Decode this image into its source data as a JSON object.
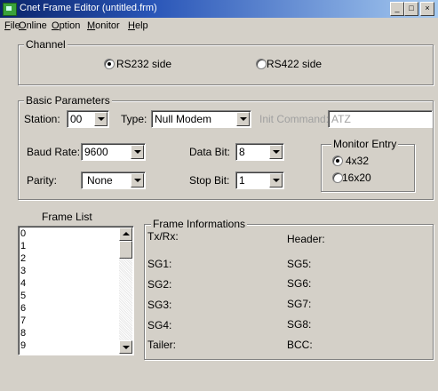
{
  "window": {
    "title": "Cnet Frame Editor (untitled.frm)",
    "min": "_",
    "max": "□",
    "close": "×"
  },
  "menu": [
    "File",
    "Online",
    "Option",
    "Monitor",
    "Help"
  ],
  "channel": {
    "legend": "Channel",
    "rs232": "RS232 side",
    "rs422": "RS422 side",
    "selected": "rs232"
  },
  "basic": {
    "legend": "Basic Parameters",
    "station_label": "Station:",
    "station": "00",
    "type_label": "Type:",
    "type": "Null Modem",
    "init_label": "Init Command:",
    "init": "ATZ",
    "baud_label": "Baud Rate:",
    "baud": "9600",
    "databit_label": "Data Bit:",
    "databit": "8",
    "parity_label": "Parity:",
    "parity": "None",
    "stopbit_label": "Stop Bit:",
    "stopbit": "1"
  },
  "monitor": {
    "legend": "Monitor Entry",
    "opt1": "4x32",
    "opt2": "16x20",
    "selected": "4x32"
  },
  "frame_list": {
    "label": "Frame List",
    "items": [
      "0",
      "1",
      "2",
      "3",
      "4",
      "5",
      "6",
      "7",
      "8",
      "9"
    ]
  },
  "frame_info": {
    "legend": "Frame Informations",
    "txrx": "Tx/Rx:",
    "header": "Header:",
    "sg1": "SG1:",
    "sg5": "SG5:",
    "sg2": "SG2:",
    "sg6": "SG6:",
    "sg3": "SG3:",
    "sg7": "SG7:",
    "sg4": "SG4:",
    "sg8": "SG8:",
    "tailer": "Tailer:",
    "bcc": "BCC:"
  }
}
